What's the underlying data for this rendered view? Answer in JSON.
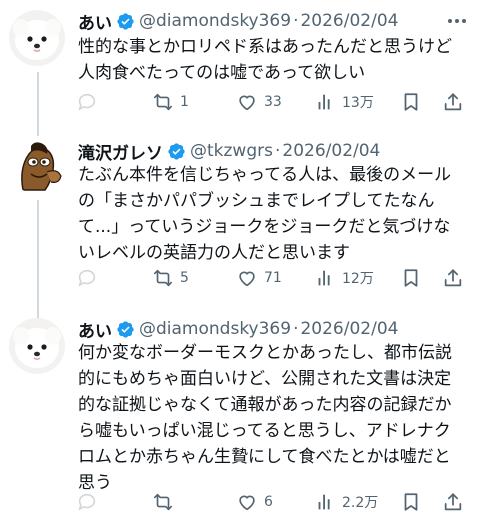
{
  "tweets": [
    {
      "name": "あい",
      "handle": "@diamondsky369",
      "sep": "·",
      "date": "2026/02/04",
      "text": "性的な事とかロリペド系はあったんだと思うけど\n人肉食べたってのは嘘であって欲しい",
      "reply_count": "",
      "retweet_count": "1",
      "like_count": "33",
      "view_count": "13万",
      "avatar": "white-dog-avatar"
    },
    {
      "name": "滝沢ガレソ",
      "handle": "@tkzwgrs",
      "sep": "·",
      "date": "2026/02/04",
      "text": "たぶん本件を信じちゃってる人は、最後のメール\nの「まさかパパブッシュまでレイプしてたなん\nて...」っていうジョークをジョークだと気づけな\nいレベルの英語力の人だと思います",
      "reply_count": "",
      "retweet_count": "5",
      "like_count": "71",
      "view_count": "12万",
      "avatar": "horse-cartoon-avatar"
    },
    {
      "name": "あい",
      "handle": "@diamondsky369",
      "sep": "·",
      "date": "2026/02/04",
      "text": "何か変なボーダーモスクとかあったし、都市伝説\n的にもめちゃ面白いけど、公開された文書は決定\n的な証拠じゃなくて通報があった内容の記録だか\nら嘘もいっぱい混じってると思うし、アドレナク\nロムとか赤ちゃん生贄にして食べたとかは嘘だと\n思う",
      "reply_count": "",
      "retweet_count": "",
      "like_count": "6",
      "view_count": "2.2万",
      "avatar": "white-dog-avatar"
    }
  ],
  "colors": {
    "text": "#0f1419",
    "muted": "#536471",
    "verified": "#1d9bf0",
    "thread_line": "#cfd9de"
  }
}
